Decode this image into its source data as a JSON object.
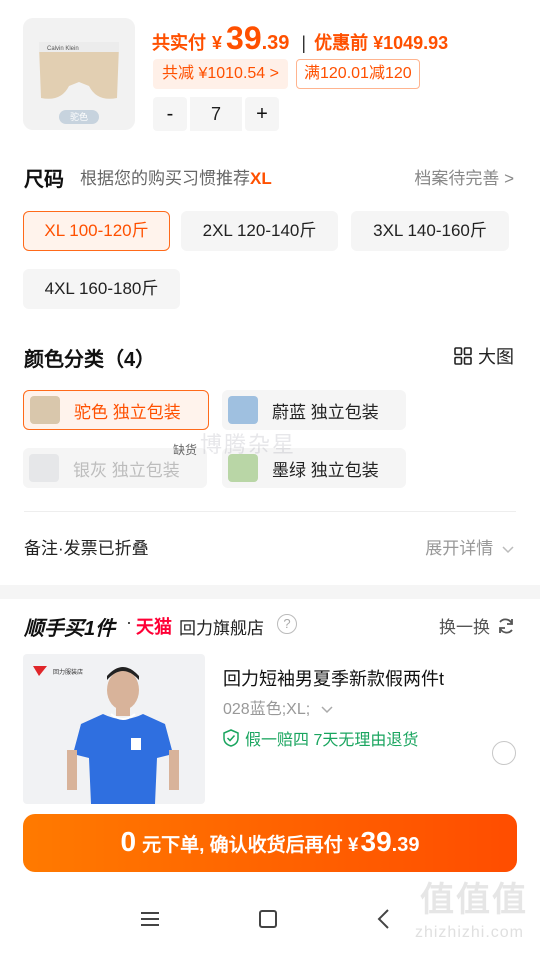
{
  "product": {
    "thumb_tag": "驼色",
    "brand_mark": "Calvin Klein",
    "paid_label": "共实付",
    "currency": "¥",
    "paid_int": "39",
    "paid_dec": ".39",
    "separator": "|",
    "orig_label": "优惠前 ¥1049.93",
    "discount_text": "共减 ¥1010.54 >",
    "promo_text": "满120.01减120",
    "qty_minus": "-",
    "qty_value": "7",
    "qty_plus": "+"
  },
  "size": {
    "title": "尺码",
    "hint_prefix": "根据您的购买习惯推荐",
    "hint_size": "XL",
    "profile_link": "档案待完善 >",
    "options": [
      {
        "label": "XL 100-120斤",
        "selected": true
      },
      {
        "label": "2XL 120-140斤",
        "selected": false
      },
      {
        "label": "3XL 140-160斤",
        "selected": false
      },
      {
        "label": "4XL 160-180斤",
        "selected": false
      }
    ]
  },
  "color": {
    "title": "颜色分类（4）",
    "big_view": "大图",
    "soldout_tag": "缺货",
    "watermark": "博腾杂星",
    "options": [
      {
        "label": "驼色 独立包装",
        "swatch": "#d9c7ac",
        "selected": true,
        "disabled": false
      },
      {
        "label": "蔚蓝 独立包装",
        "swatch": "#9fc0e0",
        "selected": false,
        "disabled": false
      },
      {
        "label": "银灰 独立包装",
        "swatch": "#d8dadd",
        "selected": false,
        "disabled": true
      },
      {
        "label": "墨绿 独立包装",
        "swatch": "#b9d6a6",
        "selected": false,
        "disabled": false
      }
    ]
  },
  "notes": {
    "label": "备注·发票已折叠",
    "expand": "展开详情"
  },
  "shunshou": {
    "title": "顺手买1件",
    "dot": "·",
    "tmall": "天猫",
    "shop": "回力旗舰店",
    "help": "?",
    "swap": "换一换",
    "item": {
      "title": "回力短袖男夏季新款假两件t",
      "spec": "028蓝色;XL;",
      "guarantee": "假一赔四  7天无理由退货",
      "image_brand": "回力服装店"
    }
  },
  "cta": {
    "num": "0",
    "text": "元下单, 确认收货后再付 ¥",
    "amount_int": "39",
    "amount_dec": ".39"
  },
  "watermark_site": {
    "logo": "值值值",
    "url": "zhizhizhi.com"
  },
  "colors": {
    "accent": "#ff5000",
    "green": "#1aa55f",
    "tmall": "#ff0036"
  }
}
